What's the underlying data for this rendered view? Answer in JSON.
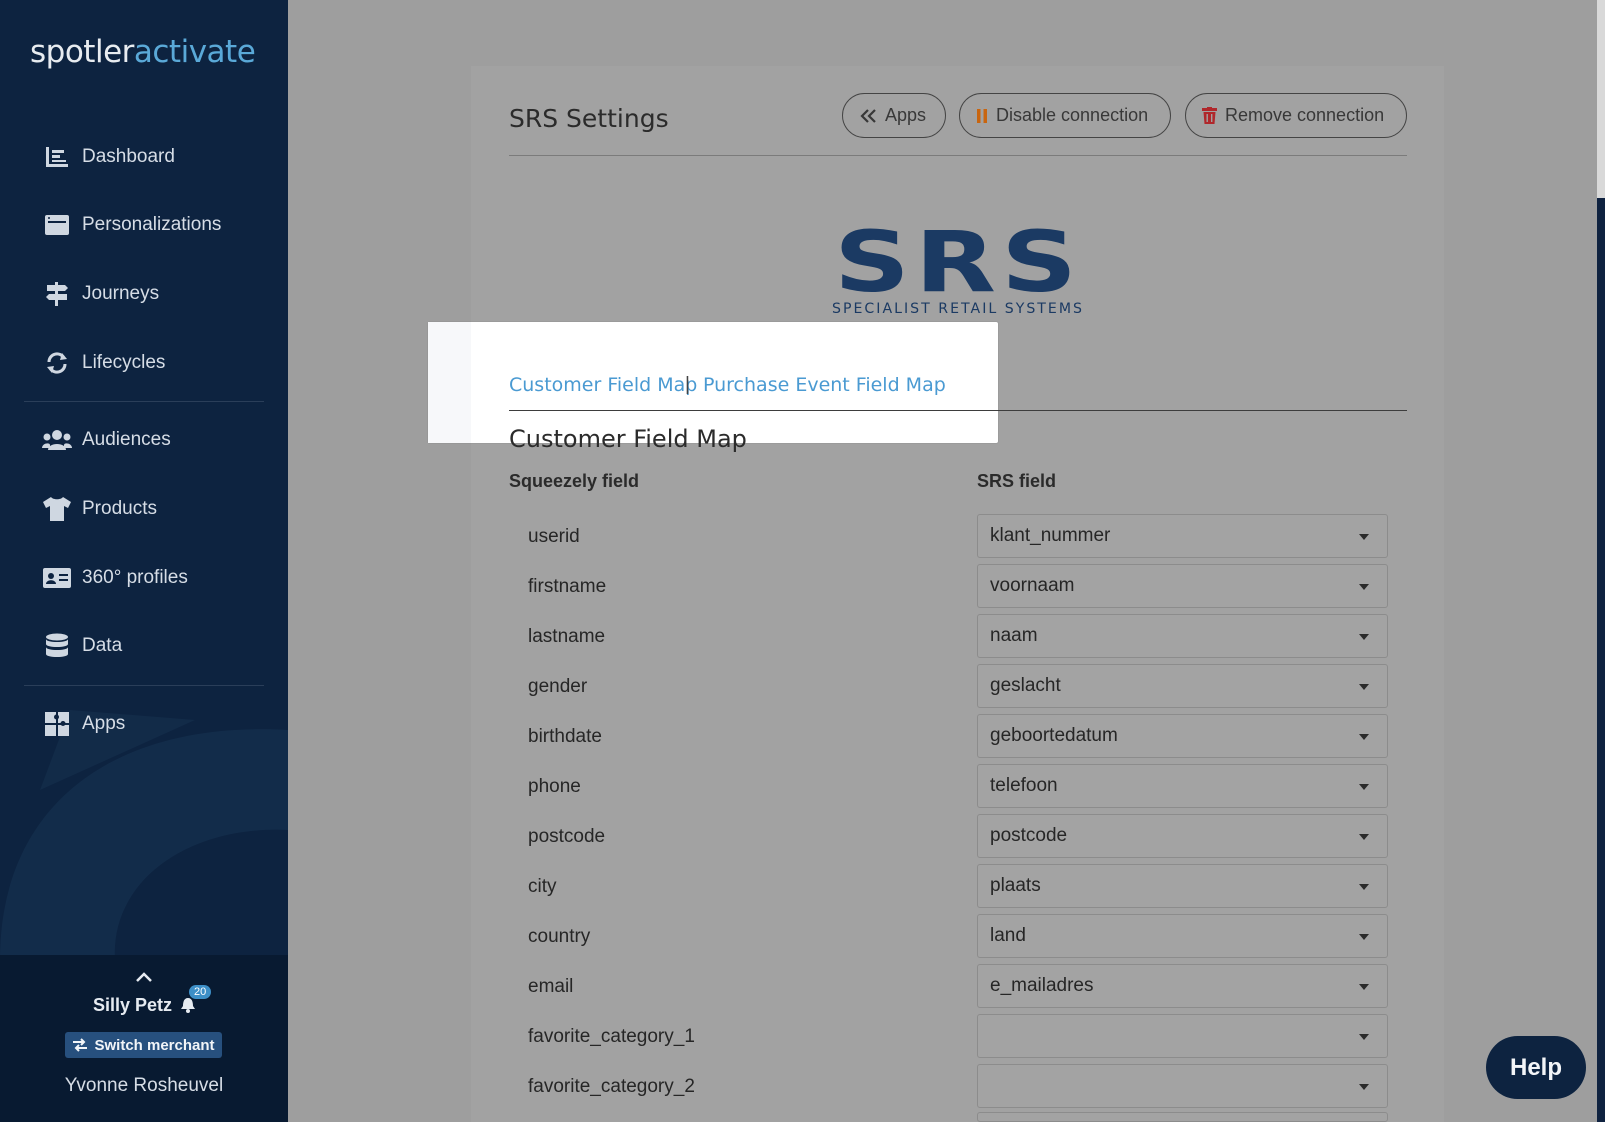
{
  "brand": {
    "logo_part1": "spotler",
    "logo_part2": "activate",
    "accent_color": "#5aa9d8",
    "sidebar_color": "#0d2340"
  },
  "sidebar": {
    "items": [
      {
        "label": "Dashboard",
        "icon": "dashboard-icon"
      },
      {
        "label": "Personalizations",
        "icon": "window-icon"
      },
      {
        "label": "Journeys",
        "icon": "signpost-icon"
      },
      {
        "label": "Lifecycles",
        "icon": "sync-icon"
      },
      {
        "label": "Audiences",
        "icon": "users-icon"
      },
      {
        "label": "Products",
        "icon": "shirt-icon"
      },
      {
        "label": "360° profiles",
        "icon": "id-card-icon"
      },
      {
        "label": "Data",
        "icon": "database-icon"
      },
      {
        "label": "Apps",
        "icon": "puzzle-icon"
      }
    ],
    "footer": {
      "merchant": "Silly Petz",
      "notification_count": "20",
      "switch_label": "Switch merchant",
      "user": "Yvonne Rosheuvel"
    }
  },
  "header": {
    "title": "SRS Settings",
    "apps_button": "Apps",
    "disable_button": "Disable connection",
    "remove_button": "Remove connection"
  },
  "srs_logo": {
    "big": "SRS",
    "subtitle": "SPECIALIST RETAIL SYSTEMS",
    "color": "#1b3a63"
  },
  "tabs": {
    "customer": "Customer Field Map",
    "separator": "|",
    "purchase": "Purchase Event Field Map"
  },
  "section": {
    "title": "Customer Field Map",
    "col_left": "Squeezely field",
    "col_right": "SRS field"
  },
  "rows": [
    {
      "field": "userid",
      "value": "klant_nummer"
    },
    {
      "field": "firstname",
      "value": "voornaam"
    },
    {
      "field": "lastname",
      "value": "naam"
    },
    {
      "field": "gender",
      "value": "geslacht"
    },
    {
      "field": "birthdate",
      "value": "geboortedatum"
    },
    {
      "field": "phone",
      "value": "telefoon"
    },
    {
      "field": "postcode",
      "value": "postcode"
    },
    {
      "field": "city",
      "value": "plaats"
    },
    {
      "field": "country",
      "value": "land"
    },
    {
      "field": "email",
      "value": "e_mailadres"
    },
    {
      "field": "favorite_category_1",
      "value": ""
    },
    {
      "field": "favorite_category_2",
      "value": ""
    }
  ],
  "help": {
    "label": "Help"
  }
}
